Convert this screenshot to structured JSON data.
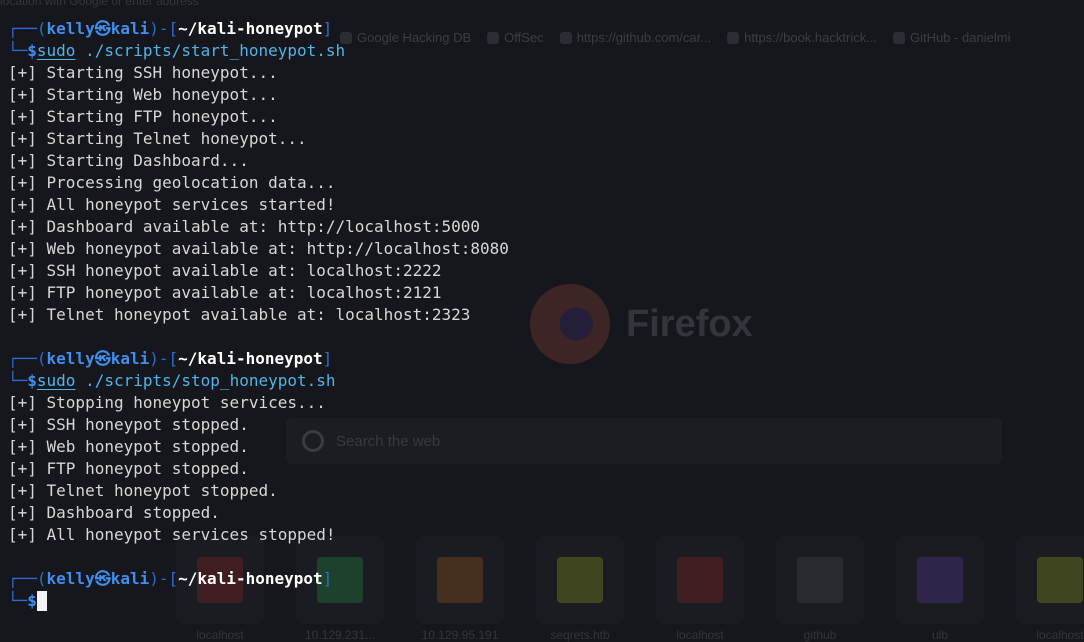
{
  "terminal": {
    "accent": "#3f8ef0",
    "command_color": "#4fb4e8",
    "text_color": "#d7d7d7",
    "background": "#16171c",
    "blocks": [
      {
        "prompt": {
          "corner_top": "┌──(",
          "user": "kelly",
          "at_icon": "㉿",
          "host": "kali",
          "mid": ")-[",
          "path": "~/kali-honeypot",
          "close": "]",
          "corner_bottom": "└─",
          "symbol": "$"
        },
        "command": "sudo",
        "args": " ./scripts/start_honeypot.sh",
        "output": [
          "[+] Starting SSH honeypot...",
          "[+] Starting Web honeypot...",
          "[+] Starting FTP honeypot...",
          "[+] Starting Telnet honeypot...",
          "[+] Starting Dashboard...",
          "[+] Processing geolocation data...",
          "[+] All honeypot services started!",
          "[+] Dashboard available at: http://localhost:5000",
          "[+] Web honeypot available at: http://localhost:8080",
          "[+] SSH honeypot available at: localhost:2222",
          "[+] FTP honeypot available at: localhost:2121",
          "[+] Telnet honeypot available at: localhost:2323"
        ]
      },
      {
        "prompt": {
          "corner_top": "┌──(",
          "user": "kelly",
          "at_icon": "㉿",
          "host": "kali",
          "mid": ")-[",
          "path": "~/kali-honeypot",
          "close": "]",
          "corner_bottom": "└─",
          "symbol": "$"
        },
        "command": "sudo",
        "args": " ./scripts/stop_honeypot.sh",
        "output": [
          "[+] Stopping honeypot services...",
          "[+] SSH honeypot stopped.",
          "[+] Web honeypot stopped.",
          "[+] FTP honeypot stopped.",
          "[+] Telnet honeypot stopped.",
          "[+] Dashboard stopped.",
          "[+] All honeypot services stopped!"
        ]
      }
    ],
    "final_prompt": {
      "corner_top": "┌──(",
      "user": "kelly",
      "at_icon": "㉿",
      "host": "kali",
      "mid": ")-[",
      "path": "~/kali-honeypot",
      "close": "]",
      "corner_bottom": "└─",
      "symbol": "$"
    }
  },
  "background_browser": {
    "top_note": "location with Google or enter address",
    "bookmarks": [
      "Google Hacking DB",
      "OffSec",
      "https://github.com/car...",
      "https://book.hacktrick...",
      "GitHub - danielmi"
    ],
    "brand": "Firefox",
    "search_placeholder": "Search the web",
    "tiles": [
      {
        "label": "localhost",
        "color": "#6e1f1f"
      },
      {
        "label": "10.129.231...",
        "color": "#1f6e3a"
      },
      {
        "label": "10.129.95.191",
        "color": "#7a4a1f"
      },
      {
        "label": "seqrets.htb",
        "color": "#6e7a1f"
      },
      {
        "label": "localhost",
        "color": "#6e1f1f"
      },
      {
        "label": "github",
        "color": "#3a3b42"
      },
      {
        "label": "ulb",
        "color": "#4a2f7a"
      },
      {
        "label": "localhost",
        "color": "#6e7a1f"
      }
    ]
  }
}
